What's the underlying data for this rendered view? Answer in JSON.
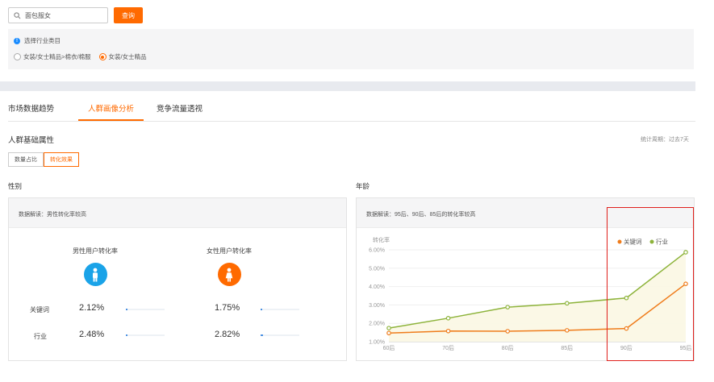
{
  "search": {
    "value": "面包服女",
    "button_label": "查询"
  },
  "category": {
    "title": "选择行业类目",
    "options": [
      {
        "label": "女装/女士精品>棉衣/棉服",
        "selected": false
      },
      {
        "label": "女装/女士精品",
        "selected": true
      }
    ]
  },
  "tabs": [
    {
      "label": "市场数据趋势",
      "active": false
    },
    {
      "label": "人群画像分析",
      "active": true
    },
    {
      "label": "竞争流量透视",
      "active": false
    }
  ],
  "section": {
    "title": "人群基础属性",
    "period": "统计周期：过去7天",
    "toggle": [
      {
        "label": "数量占比",
        "active": false
      },
      {
        "label": "转化效果",
        "active": true
      }
    ]
  },
  "gender": {
    "title": "性别",
    "insight": "数据解读：男性转化率较高",
    "male_title": "男性用户转化率",
    "female_title": "女性用户转化率",
    "rows": [
      {
        "label": "关键词",
        "male": "2.12%",
        "female": "1.75%",
        "male_level": 0.04,
        "female_level": 0.035
      },
      {
        "label": "行业",
        "male": "2.48%",
        "female": "2.82%",
        "male_level": 0.05,
        "female_level": 0.056
      }
    ],
    "colors": {
      "male": "#1aa3e8",
      "female": "#ff6a00"
    }
  },
  "age": {
    "title": "年龄",
    "insight": "数据解读：95后、90后、85后的转化率较高"
  },
  "chart_data": {
    "type": "line",
    "ylabel": "转化率",
    "categories": [
      "60后",
      "70后",
      "80后",
      "85后",
      "90后",
      "95后"
    ],
    "yticks": [
      "1.00%",
      "2.00%",
      "3.00%",
      "4.00%",
      "5.00%",
      "6.00%"
    ],
    "ylim": [
      1.0,
      6.0
    ],
    "grid": true,
    "legend": "top-right",
    "series": [
      {
        "name": "关键词",
        "color": "#ef7c1b",
        "values": [
          1.47,
          1.58,
          1.57,
          1.62,
          1.72,
          4.15
        ]
      },
      {
        "name": "行业",
        "color": "#8db33a",
        "values": [
          1.74,
          2.28,
          2.88,
          3.09,
          3.38,
          5.87
        ]
      }
    ]
  }
}
